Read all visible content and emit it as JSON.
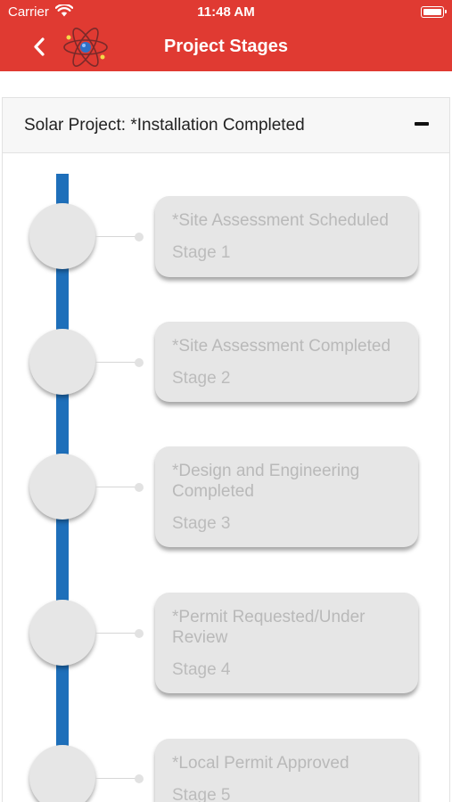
{
  "status_bar": {
    "carrier": "Carrier",
    "time": "11:48 AM"
  },
  "header": {
    "title": "Project Stages",
    "back_icon": "chevron-left-icon",
    "logo_icon": "atom-logo-icon"
  },
  "project": {
    "title": "Solar Project: *Installation Completed",
    "collapse_icon": "minus-icon"
  },
  "colors": {
    "header_bg": "#e03a32",
    "timeline": "#1e6fba",
    "card_bg": "#e6e6e6"
  },
  "stages": [
    {
      "status": "*Site Assessment Scheduled",
      "label": "Stage 1"
    },
    {
      "status": "*Site Assessment Completed",
      "label": "Stage 2"
    },
    {
      "status": "*Design and Engineering Completed",
      "label": "Stage 3"
    },
    {
      "status": "*Permit Requested/Under Review",
      "label": "Stage 4"
    },
    {
      "status": "*Local Permit Approved",
      "label": "Stage 5"
    }
  ]
}
